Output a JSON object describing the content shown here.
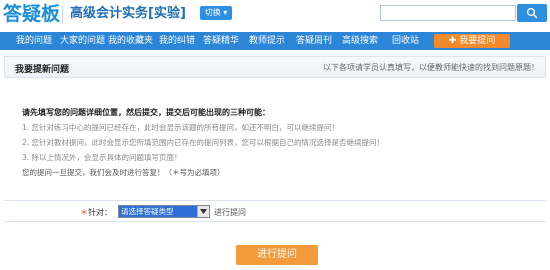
{
  "header": {
    "logo": "答疑板",
    "title": "高级会计实务[实验]",
    "switch_label": "切换",
    "search_value": ""
  },
  "nav": {
    "items": [
      "我的问题",
      "大家的问题",
      "我的收藏夹",
      "我的纠错",
      "答疑精华",
      "教师提示",
      "答疑周刊",
      "高级搜索",
      "回收站"
    ],
    "ask_label": "我要提问"
  },
  "section": {
    "title": "我要提新问题",
    "note": "以下各项请学员认真填写，以便教师能快速的找到问题原题！"
  },
  "instructions": {
    "heading": "请先填写您的问题详细位置，然后提交，提交后可能出现的三种可能：",
    "lines": [
      "1. 您针对练习中心的提问已经存在，此时会显示该题的所有提问，如还不明白，可以继续提问！",
      "2. 您针对教材提问，此时会显示您所填范围内已存在的提问列表，您可以根据自己的情况选择是否继续提问！",
      "3. 除以上情况外，会显示具体的问题填写页面！"
    ],
    "final": "您的提问一旦提交，我们会及时进行答复！（＊号为必填项）"
  },
  "form": {
    "required_mark": "＊",
    "label": "针对：",
    "select_value": "请选择答疑类型",
    "hint": "进行提问"
  },
  "submit_label": "进行提问",
  "colors": {
    "brand": "#2c86d8",
    "accent": "#f08a2c"
  }
}
